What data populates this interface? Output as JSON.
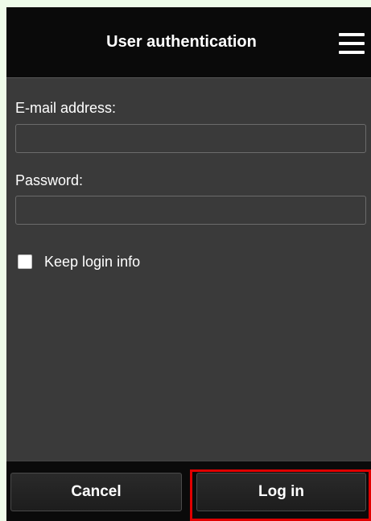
{
  "header": {
    "title": "User authentication",
    "menu_icon": "hamburger-menu-icon"
  },
  "form": {
    "email": {
      "label": "E-mail address:",
      "value": "",
      "placeholder": ""
    },
    "password": {
      "label": "Password:",
      "value": "",
      "placeholder": ""
    },
    "keep_login": {
      "label": "Keep login info",
      "checked": false
    }
  },
  "footer": {
    "cancel_label": "Cancel",
    "login_label": "Log in"
  },
  "colors": {
    "page_background": "#eefbe9",
    "panel_background": "#3a3a3a",
    "bar_background": "#0a0a0a",
    "highlight_outline": "#e00000"
  }
}
